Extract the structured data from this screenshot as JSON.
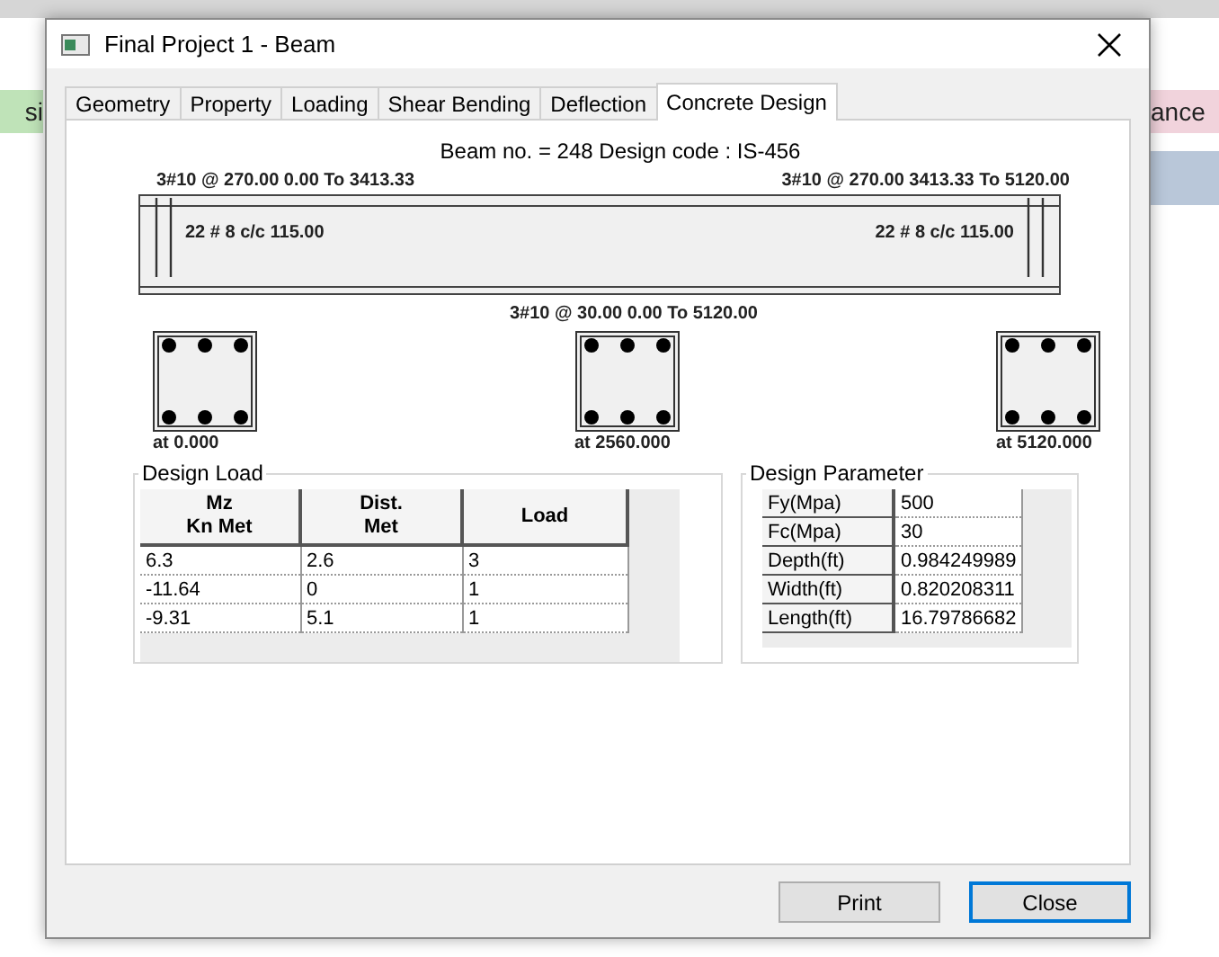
{
  "background": {
    "left_text": "si",
    "right_text": "ance"
  },
  "window": {
    "title": "Final Project 1 - Beam"
  },
  "tabs": [
    {
      "label": "Geometry",
      "selected": false
    },
    {
      "label": "Property",
      "selected": false
    },
    {
      "label": "Loading",
      "selected": false
    },
    {
      "label": "Shear Bending",
      "selected": false
    },
    {
      "label": "Deflection",
      "selected": false
    },
    {
      "label": "Concrete Design",
      "selected": true
    }
  ],
  "header": "Beam no. = 248  Design code :  IS-456",
  "top_left_label": "3#10 @ 270.00 0.00 To 3413.33",
  "top_right_label": "3#10 @ 270.00 3413.33 To 5120.00",
  "stirrup_left": "22 # 8 c/c 115.00",
  "stirrup_right": "22 # 8 c/c 115.00",
  "bottom_label": "3#10 @ 30.00 0.00 To 5120.00",
  "sections": [
    {
      "label": "at 0.000"
    },
    {
      "label": "at 2560.000"
    },
    {
      "label": "at 5120.000"
    }
  ],
  "design_load": {
    "title": "Design Load",
    "columns": [
      "Mz\nKn Met",
      "Dist.\nMet",
      "Load"
    ],
    "rows": [
      [
        "6.3",
        "2.6",
        "3"
      ],
      [
        "-11.64",
        "0",
        "1"
      ],
      [
        "-9.31",
        "5.1",
        "1"
      ]
    ]
  },
  "design_parameter": {
    "title": "Design Parameter",
    "rows": [
      {
        "name": "Fy(Mpa)",
        "value": "500"
      },
      {
        "name": "Fc(Mpa)",
        "value": "30"
      },
      {
        "name": "Depth(ft)",
        "value": "0.984249989"
      },
      {
        "name": "Width(ft)",
        "value": "0.820208311"
      },
      {
        "name": "Length(ft)",
        "value": "16.79786682"
      }
    ]
  },
  "buttons": [
    {
      "label": "Print",
      "default": false
    },
    {
      "label": "Close",
      "default": true
    }
  ]
}
